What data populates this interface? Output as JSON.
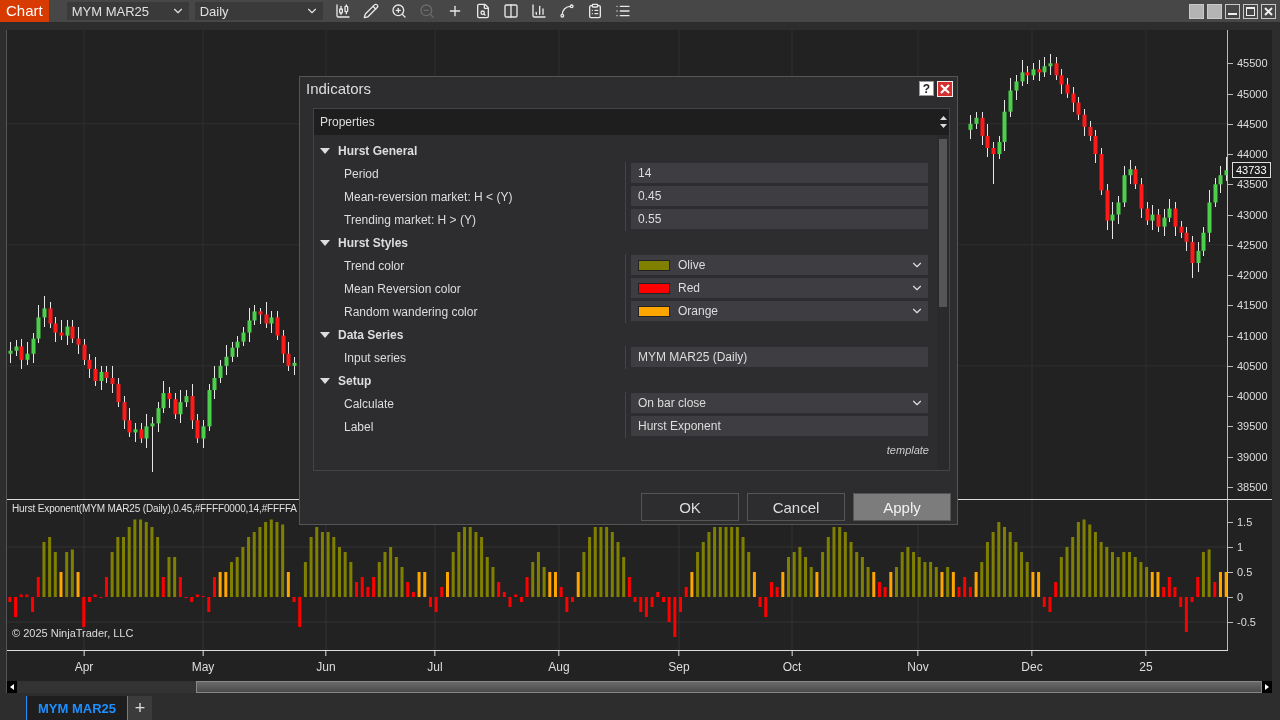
{
  "toolbar": {
    "title": "Chart",
    "instrument": "MYM MAR25",
    "interval": "Daily",
    "tools": [
      {
        "disabled": false
      },
      {
        "disabled": false
      },
      {
        "disabled": false
      },
      {
        "disabled": true
      },
      {
        "disabled": false
      },
      {
        "disabled": false
      },
      {
        "disabled": false
      },
      {
        "disabled": false
      },
      {
        "disabled": false
      },
      {
        "disabled": false
      },
      {
        "disabled": false
      }
    ]
  },
  "price_pane": {
    "current_price": "43733",
    "chart_data": {
      "type": "candlestick",
      "grid": true,
      "ylim": [
        38300,
        46050
      ],
      "yticks": [
        45500,
        45000,
        44500,
        44000,
        43500,
        43000,
        42500,
        42000,
        41500,
        41000,
        40500,
        40000,
        39500,
        39000,
        38500
      ],
      "ohlc": [
        [
          40700,
          40900,
          40550,
          40750
        ],
        [
          40750,
          40920,
          40670,
          40820
        ],
        [
          40820,
          40950,
          40450,
          40600
        ],
        [
          40600,
          40900,
          40520,
          40700
        ],
        [
          40700,
          41050,
          40550,
          40950
        ],
        [
          40950,
          41500,
          40870,
          41300
        ],
        [
          41300,
          41650,
          41150,
          41450
        ],
        [
          41450,
          41550,
          41120,
          41200
        ],
        [
          41200,
          41300,
          40900,
          41050
        ],
        [
          41050,
          41250,
          40920,
          41000
        ],
        [
          41000,
          41250,
          40850,
          41150
        ],
        [
          41150,
          41250,
          40870,
          40950
        ],
        [
          40950,
          41150,
          40700,
          40850
        ],
        [
          40850,
          40950,
          40520,
          40600
        ],
        [
          40600,
          40700,
          40300,
          40450
        ],
        [
          40450,
          40650,
          40170,
          40250
        ],
        [
          40250,
          40500,
          40100,
          40400
        ],
        [
          40400,
          40500,
          40220,
          40300
        ],
        [
          40300,
          40500,
          40050,
          40200
        ],
        [
          40200,
          40300,
          39820,
          39900
        ],
        [
          39900,
          40000,
          39450,
          39600
        ],
        [
          39600,
          39800,
          39320,
          39400
        ],
        [
          39400,
          39550,
          39250,
          39450
        ],
        [
          39450,
          39550,
          39220,
          39300
        ],
        [
          39300,
          39700,
          39150,
          39500
        ],
        [
          39500,
          39650,
          38750,
          39550
        ],
        [
          39550,
          39900,
          39400,
          39800
        ],
        [
          39800,
          40250,
          39720,
          40050
        ],
        [
          40050,
          40150,
          39800,
          39950
        ],
        [
          39950,
          40050,
          39620,
          39700
        ],
        [
          39700,
          40100,
          39550,
          39900
        ],
        [
          39900,
          40100,
          39820,
          40000
        ],
        [
          40000,
          40200,
          39450,
          39600
        ],
        [
          39600,
          39700,
          39220,
          39300
        ],
        [
          39300,
          39600,
          39150,
          39500
        ],
        [
          39500,
          40200,
          39420,
          40100
        ],
        [
          40100,
          40500,
          39950,
          40300
        ],
        [
          40300,
          40600,
          40220,
          40500
        ],
        [
          40500,
          40850,
          40350,
          40650
        ],
        [
          40650,
          40900,
          40570,
          40800
        ],
        [
          40800,
          41000,
          40650,
          40900
        ],
        [
          40900,
          41150,
          40820,
          41050
        ],
        [
          41050,
          41450,
          40900,
          41250
        ],
        [
          41250,
          41500,
          41170,
          41400
        ],
        [
          41400,
          41450,
          41200,
          41350
        ],
        [
          41350,
          41550,
          41120,
          41200
        ],
        [
          41200,
          41400,
          41050,
          41300
        ],
        [
          41300,
          41400,
          40920,
          41000
        ],
        [
          41000,
          41100,
          40550,
          40700
        ],
        [
          40700,
          40900,
          40420,
          40500
        ],
        [
          40500,
          40650,
          40350,
          40550
        ],
        null,
        null,
        null,
        null,
        null,
        null,
        null,
        null,
        null,
        null,
        null,
        null,
        null,
        null,
        null,
        null,
        null,
        null,
        null,
        null,
        null,
        null,
        null,
        null,
        null,
        null,
        null,
        null,
        null,
        null,
        null,
        null,
        null,
        null,
        null,
        null,
        null,
        null,
        null,
        null,
        null,
        null,
        null,
        null,
        null,
        null,
        null,
        null,
        null,
        null,
        null,
        null,
        null,
        null,
        null,
        null,
        null,
        null,
        null,
        null,
        null,
        null,
        null,
        null,
        null,
        null,
        null,
        null,
        null,
        null,
        null,
        null,
        null,
        null,
        null,
        null,
        null,
        null,
        null,
        null,
        null,
        null,
        null,
        null,
        null,
        null,
        null,
        null,
        null,
        null,
        null,
        null,
        null,
        null,
        null,
        null,
        null,
        null,
        null,
        null,
        null,
        null,
        null,
        null,
        null,
        null,
        null,
        null,
        null,
        null,
        null,
        null,
        null,
        null,
        null,
        null,
        null,
        null,
        [
          44400,
          44650,
          44250,
          44500
        ],
        [
          44500,
          44700,
          44420,
          44600
        ],
        [
          44600,
          44700,
          44150,
          44300
        ],
        [
          44300,
          44500,
          43950,
          44100
        ],
        [
          44100,
          44200,
          43500,
          44000
        ],
        [
          44000,
          44300,
          43920,
          44200
        ],
        [
          44200,
          44900,
          44050,
          44700
        ],
        [
          44700,
          45250,
          44620,
          45050
        ],
        [
          45050,
          45300,
          44900,
          45200
        ],
        [
          45200,
          45550,
          45120,
          45350
        ],
        [
          45350,
          45450,
          45150,
          45300
        ],
        [
          45300,
          45500,
          45220,
          45400
        ],
        [
          45400,
          45550,
          45200,
          45350
        ],
        [
          45350,
          45600,
          45270,
          45450
        ],
        [
          45450,
          45650,
          45300,
          45500
        ],
        [
          45500,
          45600,
          45220,
          45300
        ],
        [
          45300,
          45400,
          45000,
          45150
        ],
        [
          45150,
          45250,
          44920,
          45000
        ],
        [
          45000,
          45100,
          44700,
          44850
        ],
        [
          44850,
          44950,
          44570,
          44650
        ],
        [
          44650,
          44750,
          44300,
          44450
        ],
        [
          44450,
          44550,
          44220,
          44300
        ],
        [
          44300,
          44400,
          43850,
          44000
        ],
        [
          44000,
          44100,
          43320,
          43400
        ],
        [
          43400,
          43500,
          42750,
          42900
        ],
        [
          42900,
          43200,
          42600,
          43000
        ],
        [
          43000,
          43300,
          42850,
          43200
        ],
        [
          43200,
          43800,
          43120,
          43650
        ],
        [
          43650,
          43900,
          43500,
          43750
        ],
        [
          43750,
          43800,
          43420,
          43500
        ],
        [
          43500,
          43600,
          42950,
          43100
        ],
        [
          43100,
          43200,
          42820,
          42900
        ],
        [
          42900,
          43150,
          42750,
          43000
        ],
        [
          43000,
          43100,
          42720,
          42800
        ],
        [
          42800,
          43100,
          42650,
          42950
        ],
        [
          42950,
          43250,
          42870,
          43100
        ],
        [
          43100,
          43200,
          42650,
          42800
        ],
        [
          42800,
          42900,
          42620,
          42700
        ],
        [
          42700,
          42800,
          42400,
          42550
        ],
        [
          42550,
          42650,
          41950,
          42200
        ],
        [
          42200,
          42550,
          42050,
          42400
        ],
        [
          42400,
          42800,
          42320,
          42700
        ],
        [
          42700,
          43400,
          42550,
          43200
        ],
        [
          43200,
          43600,
          43120,
          43500
        ],
        [
          43500,
          43800,
          43350,
          43650
        ],
        [
          43650,
          43950,
          43550,
          43733
        ]
      ]
    }
  },
  "indicator_pane": {
    "label": "Hurst Exponent(MYM MAR25 (Daily),0.45,#FFFF0000,14,#FFFFA",
    "copyright": "© 2025 NinjaTrader, LLC",
    "chart_data": {
      "type": "bar",
      "grid": true,
      "ylim": [
        -1.06,
        1.94
      ],
      "yticks": [
        1.5,
        1,
        0.5,
        0,
        -0.5
      ],
      "values": [
        -0.1,
        -0.4,
        0.05,
        0.05,
        -0.3,
        0.4,
        1.1,
        1.2,
        0.9,
        0.5,
        0.9,
        0.95,
        0.5,
        -0.6,
        -0.1,
        0.05,
        0,
        0.4,
        0.9,
        1.2,
        1.2,
        1.4,
        1.55,
        1.55,
        1.5,
        1.4,
        1.2,
        0.4,
        0.8,
        0.8,
        0.4,
        0,
        -0.1,
        0.05,
        0.02,
        -0.3,
        0.4,
        0.5,
        0.5,
        0.7,
        0.8,
        1.0,
        1.2,
        1.3,
        1.4,
        1.5,
        1.55,
        1.5,
        1.45,
        0.5,
        -0.1,
        -0.6,
        0.7,
        1.2,
        1.4,
        1.3,
        1.3,
        1.2,
        1.0,
        0.9,
        0.7,
        0.3,
        0.4,
        0.2,
        0.4,
        0.7,
        0.9,
        1.0,
        0.8,
        0.6,
        0.3,
        0.1,
        0.5,
        0.5,
        -0.2,
        -0.3,
        0.2,
        0.5,
        0.9,
        1.3,
        1.4,
        1.4,
        1.3,
        1.2,
        0.8,
        0.6,
        0.3,
        0.1,
        -0.2,
        0.05,
        -0.1,
        0.4,
        0.7,
        0.9,
        0.6,
        0.5,
        0.5,
        0.2,
        -0.3,
        -0.1,
        0.5,
        0.9,
        1.2,
        1.4,
        1.4,
        1.4,
        1.3,
        1.1,
        0.8,
        0.4,
        -0.1,
        -0.3,
        -0.4,
        -0.2,
        0.1,
        -0.1,
        -0.5,
        -0.8,
        -0.3,
        0.2,
        0.5,
        0.9,
        1.1,
        1.3,
        1.4,
        1.4,
        1.4,
        1.4,
        1.4,
        1.2,
        0.9,
        0.5,
        -0.2,
        -0.4,
        0.3,
        0.2,
        0.5,
        0.8,
        0.9,
        1.0,
        0.8,
        0.6,
        0.5,
        0.9,
        1.2,
        1.4,
        1.4,
        1.3,
        1.1,
        0.9,
        0.8,
        0.6,
        0.5,
        0.3,
        0.2,
        0.5,
        0.6,
        0.9,
        1.0,
        0.9,
        0.8,
        0.7,
        0.7,
        0.6,
        0.5,
        0.6,
        0.5,
        0.2,
        0.4,
        0.2,
        0.5,
        0.7,
        1.1,
        1.3,
        1.5,
        1.4,
        1.3,
        1.1,
        0.9,
        0.7,
        0.5,
        0.5,
        -0.2,
        -0.3,
        0.3,
        0.8,
        1.0,
        1.2,
        1.5,
        1.55,
        1.45,
        1.3,
        1.1,
        1.0,
        0.9,
        0.8,
        0.9,
        0.9,
        0.8,
        0.7,
        0.6,
        0.5,
        0.5,
        0.2,
        0.4,
        0.2,
        -0.2,
        -0.7,
        -0.1,
        0.4,
        0.9,
        0.95,
        0.3,
        0.5,
        0.5
      ]
    }
  },
  "time_axis": {
    "labels": [
      "Apr",
      "May",
      "Jun",
      "Jul",
      "Aug",
      "Sep",
      "Oct",
      "Nov",
      "Dec",
      "25"
    ]
  },
  "tabs": [
    {
      "label": "MYM MAR25",
      "selected": true
    }
  ],
  "add_tab": "+",
  "dialog": {
    "title": "Indicators",
    "help": "?",
    "panel_title": "Properties",
    "categories": [
      {
        "label": "Hurst General",
        "expanded": true,
        "properties": [
          {
            "label": "Period",
            "kind": "text",
            "value": "14"
          },
          {
            "label": "Mean-reversion market: H < (Y)",
            "kind": "text",
            "value": "0.45"
          },
          {
            "label": "Trending market: H > (Y)",
            "kind": "text",
            "value": "0.55"
          }
        ]
      },
      {
        "label": "Hurst Styles",
        "expanded": true,
        "properties": [
          {
            "label": "Trend color",
            "kind": "color",
            "value": "Olive",
            "color": "#808000"
          },
          {
            "label": "Mean Reversion color",
            "kind": "color",
            "value": "Red",
            "color": "#ff0000"
          },
          {
            "label": "Random wandering color",
            "kind": "color",
            "value": "Orange",
            "color": "#ffa500"
          }
        ]
      },
      {
        "label": "Data Series",
        "expanded": true,
        "properties": [
          {
            "label": "Input series",
            "kind": "text",
            "value": "MYM MAR25 (Daily)"
          }
        ]
      },
      {
        "label": "Setup",
        "expanded": true,
        "properties": [
          {
            "label": "Calculate",
            "kind": "dropdown",
            "value": "On bar close"
          },
          {
            "label": "Label",
            "kind": "text",
            "value": "Hurst Exponent"
          }
        ]
      }
    ],
    "template_link": "template",
    "buttons": [
      {
        "label": "OK",
        "disabled": false
      },
      {
        "label": "Cancel",
        "disabled": false
      },
      {
        "label": "Apply",
        "disabled": true
      }
    ]
  }
}
